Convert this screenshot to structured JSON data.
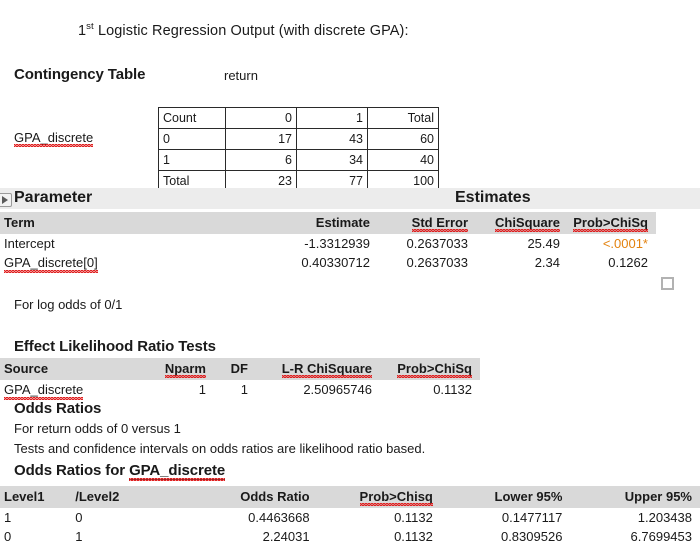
{
  "title": {
    "prefix": "1",
    "superscript": "st",
    "rest": " Logistic Regression Output (with discrete GPA):"
  },
  "contingency": {
    "heading": "Contingency Table",
    "response_label": "return",
    "row_variable_label": "GPA_discrete",
    "columns": [
      "Count",
      "0",
      "1",
      "Total"
    ],
    "rows": [
      [
        "0",
        "17",
        "43",
        "60"
      ],
      [
        "1",
        "6",
        "34",
        "40"
      ],
      [
        "Total",
        "23",
        "77",
        "100"
      ]
    ]
  },
  "parameter_estimates": {
    "title_left": "Parameter",
    "title_right": "Estimates",
    "columns": [
      "Term",
      "Estimate",
      "Std Error",
      "ChiSquare",
      "Prob>ChiSq"
    ],
    "rows": [
      {
        "term": "Intercept",
        "estimate": "-1.3312939",
        "std_error": "0.2637033",
        "chisquare": "25.49",
        "prob": "<.0001*",
        "prob_significant": true,
        "term_squiggle": false
      },
      {
        "term": "GPA_discrete[0]",
        "estimate": "0.40330712",
        "std_error": "0.2637033",
        "chisquare": "2.34",
        "prob": "0.1262",
        "prob_significant": false,
        "term_squiggle": true
      }
    ],
    "footnote": "For log odds of 0/1",
    "significant_color": "#e3820f"
  },
  "effect_likelihood": {
    "heading": "Effect Likelihood Ratio Tests",
    "columns": [
      "Source",
      "Nparm",
      "DF",
      "L-R ChiSquare",
      "Prob>ChiSq"
    ],
    "rows": [
      [
        "GPA_discrete",
        "1",
        "1",
        "2.50965746",
        "0.1132"
      ]
    ]
  },
  "odds_ratios": {
    "heading": "Odds Ratios",
    "note1": "For return odds of 0 versus 1",
    "note2": "Tests and confidence intervals on odds ratios are likelihood ratio based.",
    "subheading_prefix": "Odds Ratios for ",
    "subheading_variable": "GPA_discrete",
    "columns": [
      "Level1",
      "/Level2",
      "Odds Ratio",
      "Prob>Chisq",
      "Lower 95%",
      "Upper 95%"
    ],
    "rows": [
      [
        "1",
        "0",
        "0.4463668",
        "0.1132",
        "0.1477117",
        "1.203438"
      ],
      [
        "0",
        "1",
        "2.24031",
        "0.1132",
        "0.8309526",
        "6.7699453"
      ]
    ]
  },
  "icons": {
    "disclosure": "disclosure-triangle-icon",
    "resize": "resize-handle-icon"
  }
}
